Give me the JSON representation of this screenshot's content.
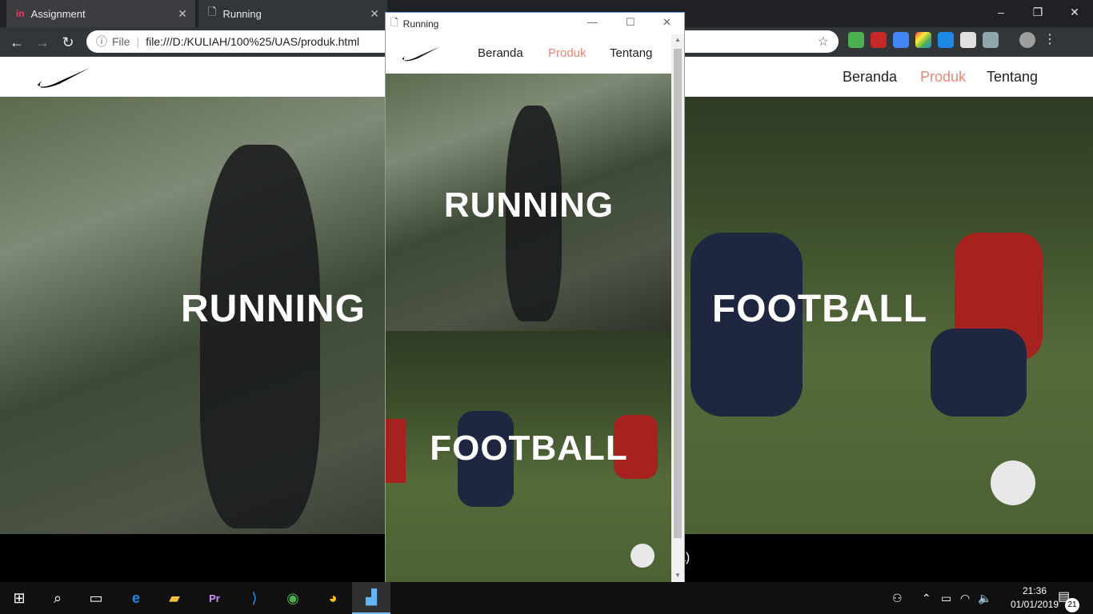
{
  "browser": {
    "tabs": [
      {
        "label": "Assignment",
        "icon": "invision-icon",
        "active": false
      },
      {
        "label": "Running",
        "icon": "document-icon",
        "active": true
      }
    ],
    "address": {
      "scheme_label": "File",
      "url": "file:///D:/KULIAH/100%25/UAS/produk.html"
    }
  },
  "page": {
    "nav": [
      {
        "label": "Beranda",
        "active": false
      },
      {
        "label": "Produk",
        "active": true
      },
      {
        "label": "Tentang",
        "active": false
      }
    ],
    "panels": [
      {
        "title": "RUNNING"
      },
      {
        "title": "FOOTBALL"
      }
    ],
    "footer_fragment": "a)"
  },
  "popup": {
    "title": "Running",
    "nav": [
      {
        "label": "Beranda",
        "active": false
      },
      {
        "label": "Produk",
        "active": true
      },
      {
        "label": "Tentang",
        "active": false
      }
    ],
    "panels": [
      {
        "title": "RUNNING"
      },
      {
        "title": "FOOTBALL"
      }
    ]
  },
  "taskbar": {
    "apps": [
      "windows-start-icon",
      "search-icon",
      "task-view-icon",
      "edge-icon",
      "file-explorer-icon",
      "premiere-icon",
      "vscode-icon",
      "app-globe-icon",
      "chrome-icon",
      "app-active-icon"
    ],
    "time": "21:36",
    "date": "01/01/2019",
    "notifications": "21"
  },
  "colors": {
    "accent_link": "#e8887a",
    "chrome_dark": "#323639",
    "taskbar": "#101010"
  }
}
